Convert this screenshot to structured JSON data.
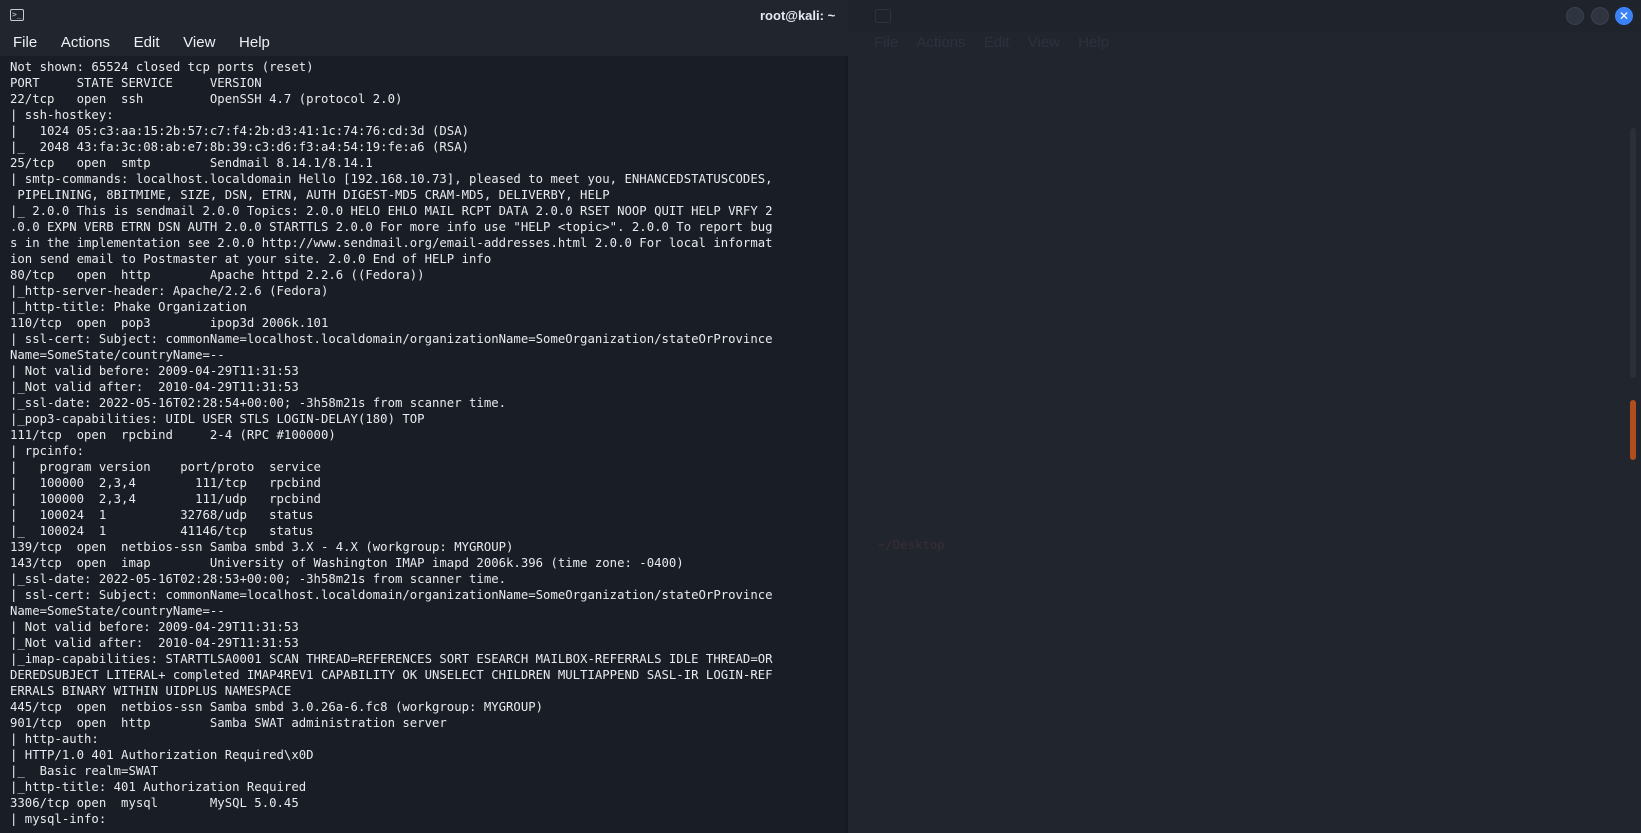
{
  "active_window": {
    "title": "root@kali: ~",
    "icon": "terminal-icon",
    "menu": [
      "File",
      "Actions",
      "Edit",
      "View",
      "Help"
    ],
    "lines": [
      "Not shown: 65524 closed tcp ports (reset)",
      "PORT     STATE SERVICE     VERSION",
      "22/tcp   open  ssh         OpenSSH 4.7 (protocol 2.0)",
      "| ssh-hostkey:",
      "|   1024 05:c3:aa:15:2b:57:c7:f4:2b:d3:41:1c:74:76:cd:3d (DSA)",
      "|_  2048 43:fa:3c:08:ab:e7:8b:39:c3:d6:f3:a4:54:19:fe:a6 (RSA)",
      "25/tcp   open  smtp        Sendmail 8.14.1/8.14.1",
      "| smtp-commands: localhost.localdomain Hello [192.168.10.73], pleased to meet you, ENHANCEDSTATUSCODES,",
      " PIPELINING, 8BITMIME, SIZE, DSN, ETRN, AUTH DIGEST-MD5 CRAM-MD5, DELIVERBY, HELP",
      "|_ 2.0.0 This is sendmail 2.0.0 Topics: 2.0.0 HELO EHLO MAIL RCPT DATA 2.0.0 RSET NOOP QUIT HELP VRFY 2",
      ".0.0 EXPN VERB ETRN DSN AUTH 2.0.0 STARTTLS 2.0.0 For more info use \"HELP <topic>\". 2.0.0 To report bug",
      "s in the implementation see 2.0.0 http://www.sendmail.org/email-addresses.html 2.0.0 For local informat",
      "ion send email to Postmaster at your site. 2.0.0 End of HELP info",
      "80/tcp   open  http        Apache httpd 2.2.6 ((Fedora))",
      "|_http-server-header: Apache/2.2.6 (Fedora)",
      "|_http-title: Phake Organization",
      "110/tcp  open  pop3        ipop3d 2006k.101",
      "| ssl-cert: Subject: commonName=localhost.localdomain/organizationName=SomeOrganization/stateOrProvince",
      "Name=SomeState/countryName=--",
      "| Not valid before: 2009-04-29T11:31:53",
      "|_Not valid after:  2010-04-29T11:31:53",
      "|_ssl-date: 2022-05-16T02:28:54+00:00; -3h58m21s from scanner time.",
      "|_pop3-capabilities: UIDL USER STLS LOGIN-DELAY(180) TOP",
      "111/tcp  open  rpcbind     2-4 (RPC #100000)",
      "| rpcinfo:",
      "|   program version    port/proto  service",
      "|   100000  2,3,4        111/tcp   rpcbind",
      "|   100000  2,3,4        111/udp   rpcbind",
      "|   100024  1          32768/udp   status",
      "|_  100024  1          41146/tcp   status",
      "139/tcp  open  netbios-ssn Samba smbd 3.X - 4.X (workgroup: MYGROUP)",
      "143/tcp  open  imap        University of Washington IMAP imapd 2006k.396 (time zone: -0400)",
      "|_ssl-date: 2022-05-16T02:28:53+00:00; -3h58m21s from scanner time.",
      "| ssl-cert: Subject: commonName=localhost.localdomain/organizationName=SomeOrganization/stateOrProvince",
      "Name=SomeState/countryName=--",
      "| Not valid before: 2009-04-29T11:31:53",
      "|_Not valid after:  2010-04-29T11:31:53",
      "|_imap-capabilities: STARTTLSA0001 SCAN THREAD=REFERENCES SORT ESEARCH MAILBOX-REFERRALS IDLE THREAD=OR",
      "DEREDSUBJECT LITERAL+ completed IMAP4REV1 CAPABILITY OK UNSELECT CHILDREN MULTIAPPEND SASL-IR LOGIN-REF",
      "ERRALS BINARY WITHIN UIDPLUS NAMESPACE",
      "445/tcp  open  netbios-ssn Samba smbd 3.0.26a-6.fc8 (workgroup: MYGROUP)",
      "901/tcp  open  http        Samba SWAT administration server",
      "| http-auth:",
      "| HTTP/1.0 401 Authorization Required\\x0D",
      "|_  Basic realm=SWAT",
      "|_http-title: 401 Authorization Required",
      "3306/tcp open  mysql       MySQL 5.0.45",
      "| mysql-info:"
    ]
  },
  "background_window": {
    "menu": [
      "File",
      "Actions",
      "Edit",
      "View",
      "Help"
    ],
    "prompt": "~/Desktop",
    "window_controls": [
      "minimize-button",
      "maximize-button",
      "close-button"
    ],
    "close_glyph": "✕"
  },
  "colors": {
    "terminal_bg": "#191d25",
    "text": "#e8eaee",
    "close_button": "#3b82f6"
  }
}
